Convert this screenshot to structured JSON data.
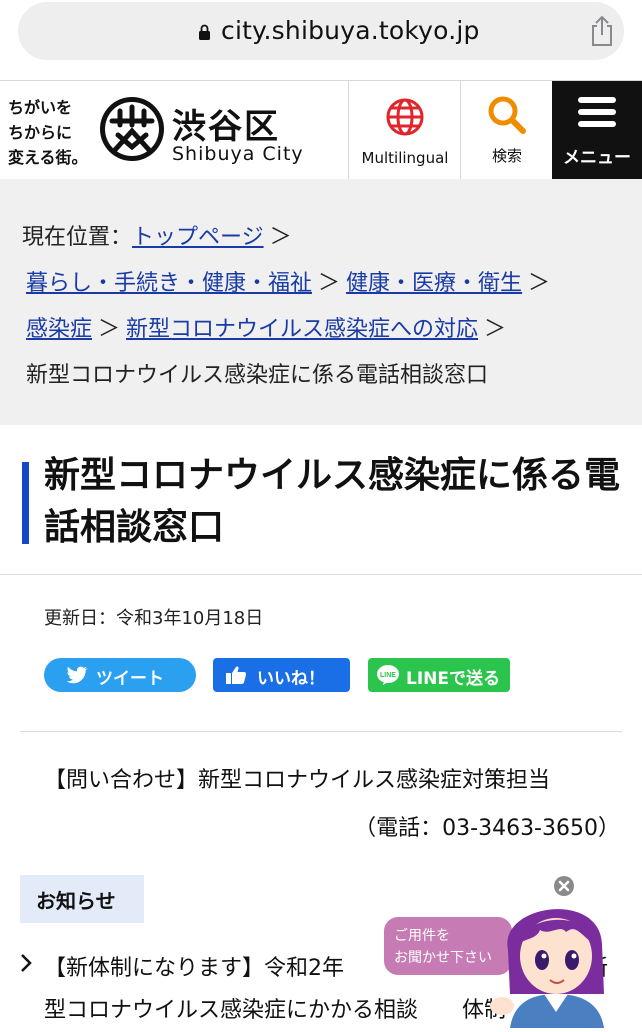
{
  "browser": {
    "url": "city.shibuya.tokyo.jp"
  },
  "header": {
    "tagline": [
      "ちがいを",
      "ちからに",
      "変える街。"
    ],
    "logo_ja": "渋谷区",
    "logo_en": "Shibuya City",
    "multilingual_label": "Multilingual",
    "search_label": "検索",
    "menu_label": "メニュー"
  },
  "breadcrumb": {
    "prefix": "現在位置：",
    "links": [
      "トップページ",
      "暮らし・手続き・健康・福祉",
      "健康・医療・衛生",
      "感染症",
      "新型コロナウイルス感染症への対応"
    ],
    "separator": "＞",
    "current": "新型コロナウイルス感染症に係る電話相談窓口"
  },
  "page": {
    "title": "新型コロナウイルス感染症に係る電話相談窓口",
    "updated": "更新日：令和3年10月18日"
  },
  "share": {
    "tweet": "ツイート",
    "like": "いいね！",
    "line": "LINEで送る"
  },
  "contact": {
    "line1": "【問い合わせ】新型コロナウイルス感染症対策担当",
    "line2": "（電話：03-3463-3650）"
  },
  "news": {
    "heading": "お知らせ",
    "item1": "【新体制になります】令和2年　　　　　　　　　　　新型コロナウイルス感染症にかかる相談　　体制"
  },
  "assistant": {
    "bubble_line1": "ご用件を",
    "bubble_line2": "お聞かせ下さい"
  },
  "colors": {
    "link": "#1a3ba6",
    "title_accent": "#1a47c8",
    "menu_bg": "#111111",
    "multilingual_icon": "#e0262b",
    "search_icon": "#f08c00",
    "tweet": "#2b9ff0",
    "like": "#1a6fe6",
    "line": "#2bc44c"
  }
}
